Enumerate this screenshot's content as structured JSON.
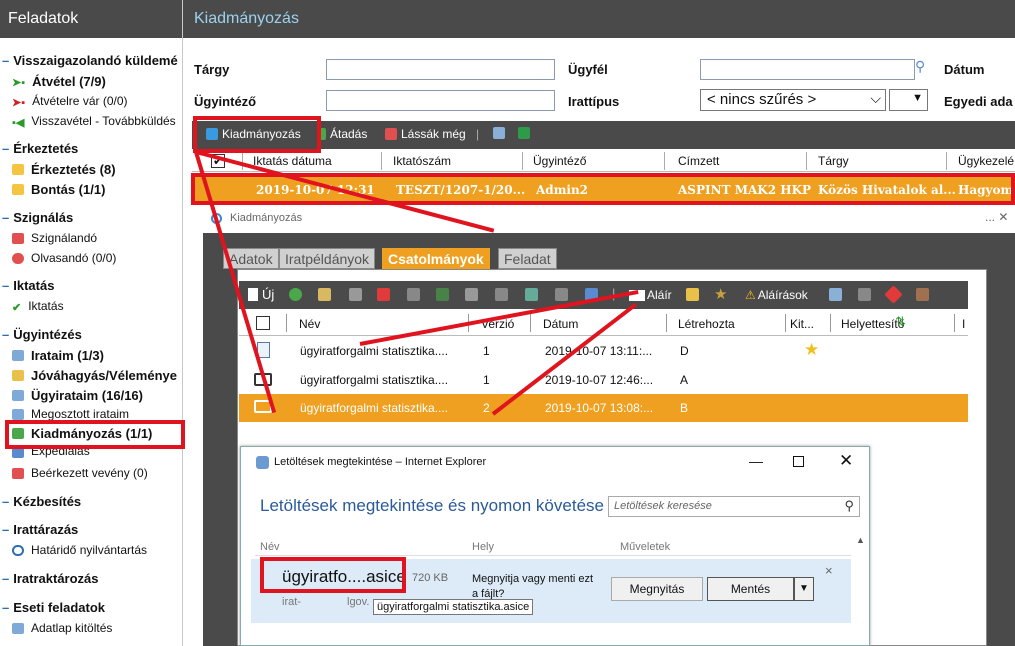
{
  "sidebar": {
    "title": "Feladatok",
    "sections": [
      {
        "label": "Visszaigazolandó küldemé",
        "items": [
          {
            "label": "Átvétel (7/9)",
            "bold": true
          },
          {
            "label": "Átvételre vár (0/0)",
            "bold": false
          },
          {
            "label": "Visszavétel - Továbbküldés",
            "bold": false
          }
        ]
      },
      {
        "label": "Érkeztetés",
        "items": [
          {
            "label": "Érkeztetés (8)",
            "bold": true
          },
          {
            "label": "Bontás (1/1)",
            "bold": true
          }
        ]
      },
      {
        "label": "Szignálás",
        "items": [
          {
            "label": "Szignálandó",
            "bold": false
          },
          {
            "label": "Olvasandó (0/0)",
            "bold": false
          }
        ]
      },
      {
        "label": "Iktatás",
        "items": [
          {
            "label": "Iktatás",
            "bold": false
          }
        ]
      },
      {
        "label": "Ügyintézés",
        "items": [
          {
            "label": "Irataim (1/3)",
            "bold": true
          },
          {
            "label": "Jóváhagyás/Véleménye",
            "bold": true
          },
          {
            "label": "Ügyirataim (16/16)",
            "bold": true
          },
          {
            "label": "Megosztott irataim",
            "bold": false
          },
          {
            "label": "Kiadmányozás (1/1)",
            "bold": true
          },
          {
            "label": "Expediálás",
            "bold": false
          },
          {
            "label": "Beérkezett vevény (0)",
            "bold": false
          }
        ]
      },
      {
        "label": "Kézbesítés",
        "items": []
      },
      {
        "label": "Irattárazás",
        "items": [
          {
            "label": "Határidő nyilvántartás",
            "bold": false
          }
        ]
      },
      {
        "label": "Iratraktározás",
        "items": []
      },
      {
        "label": "Eseti feladatok",
        "items": [
          {
            "label": "Adatlap kitöltés",
            "bold": false
          }
        ]
      }
    ]
  },
  "header": {
    "title": "Kiadmányozás"
  },
  "filters": {
    "targy": "Tárgy",
    "ugyfel": "Ügyfél",
    "datum": "Dátum",
    "ugyintezo": "Ügyintéző",
    "irattipus": "Irattípus",
    "irattipus_value": "< nincs szűrés >",
    "egyedi": "Egyedi ada"
  },
  "toolbar": {
    "kiadmanyozas": "Kiadmányozás",
    "atadas": "Átadás",
    "lassak": "Lássák még"
  },
  "grid": {
    "columns": [
      "Iktatás dátuma",
      "Iktatószám",
      "Ügyintéző",
      "Címzett",
      "Tárgy",
      "Ügykezelé"
    ],
    "selected_row": [
      "2019-10-07 12:31",
      "TESZT/1207-1/20...",
      "Admin2",
      "ASPINT MAK2 HKP",
      "Közös Hivatalok al...",
      "Hagyom"
    ]
  },
  "dialog": {
    "title": "Kiadmányozás",
    "controls": "... ✕",
    "tabs": [
      "Adatok",
      "Iratpéldányok",
      "Csatolmányok",
      "Feladat"
    ],
    "toolbar": {
      "uj": "Új",
      "alair": "Aláír",
      "alairasok": "Aláírások"
    },
    "columns": [
      "Név",
      "Verzió",
      "Dátum",
      "Létrehozta",
      "Kit...",
      "Helyettesítő",
      "I"
    ],
    "rows": [
      {
        "name": "ügyiratforgalmi statisztika....",
        "version": "1",
        "date": "2019-10-07 13:11:...",
        "creator": "D",
        "starred": true
      },
      {
        "name": "ügyiratforgalmi statisztika....",
        "version": "1",
        "date": "2019-10-07 12:46:...",
        "creator": "A",
        "starred": false
      },
      {
        "name": "ügyiratforgalmi statisztika....",
        "version": "2",
        "date": "2019-10-07 13:08:...",
        "creator": "B",
        "starred": false
      }
    ]
  },
  "ie": {
    "window_title": "Letöltések megtekintése – Internet Explorer",
    "heading": "Letöltések megtekintése és nyomon követése",
    "search_placeholder": "Letöltések keresése",
    "col_name": "Név",
    "col_location": "Hely",
    "col_actions": "Műveletek",
    "file_name": "ügyiratfo....asice",
    "file_size": "720 KB",
    "file_sub1": "irat-",
    "file_sub2": "lgov.",
    "message": "Megnyitja vagy menti ezt a fájlt?",
    "tooltip": "ügyiratforgalmi statisztika.asice",
    "open_label": "Megnyitás",
    "save_label": "Mentés",
    "close_x": "×"
  },
  "colors": {
    "accent": "#f0a020",
    "dark": "#4a4a4a",
    "highlight": "#e0141e",
    "link_blue": "#2c6fb0"
  }
}
